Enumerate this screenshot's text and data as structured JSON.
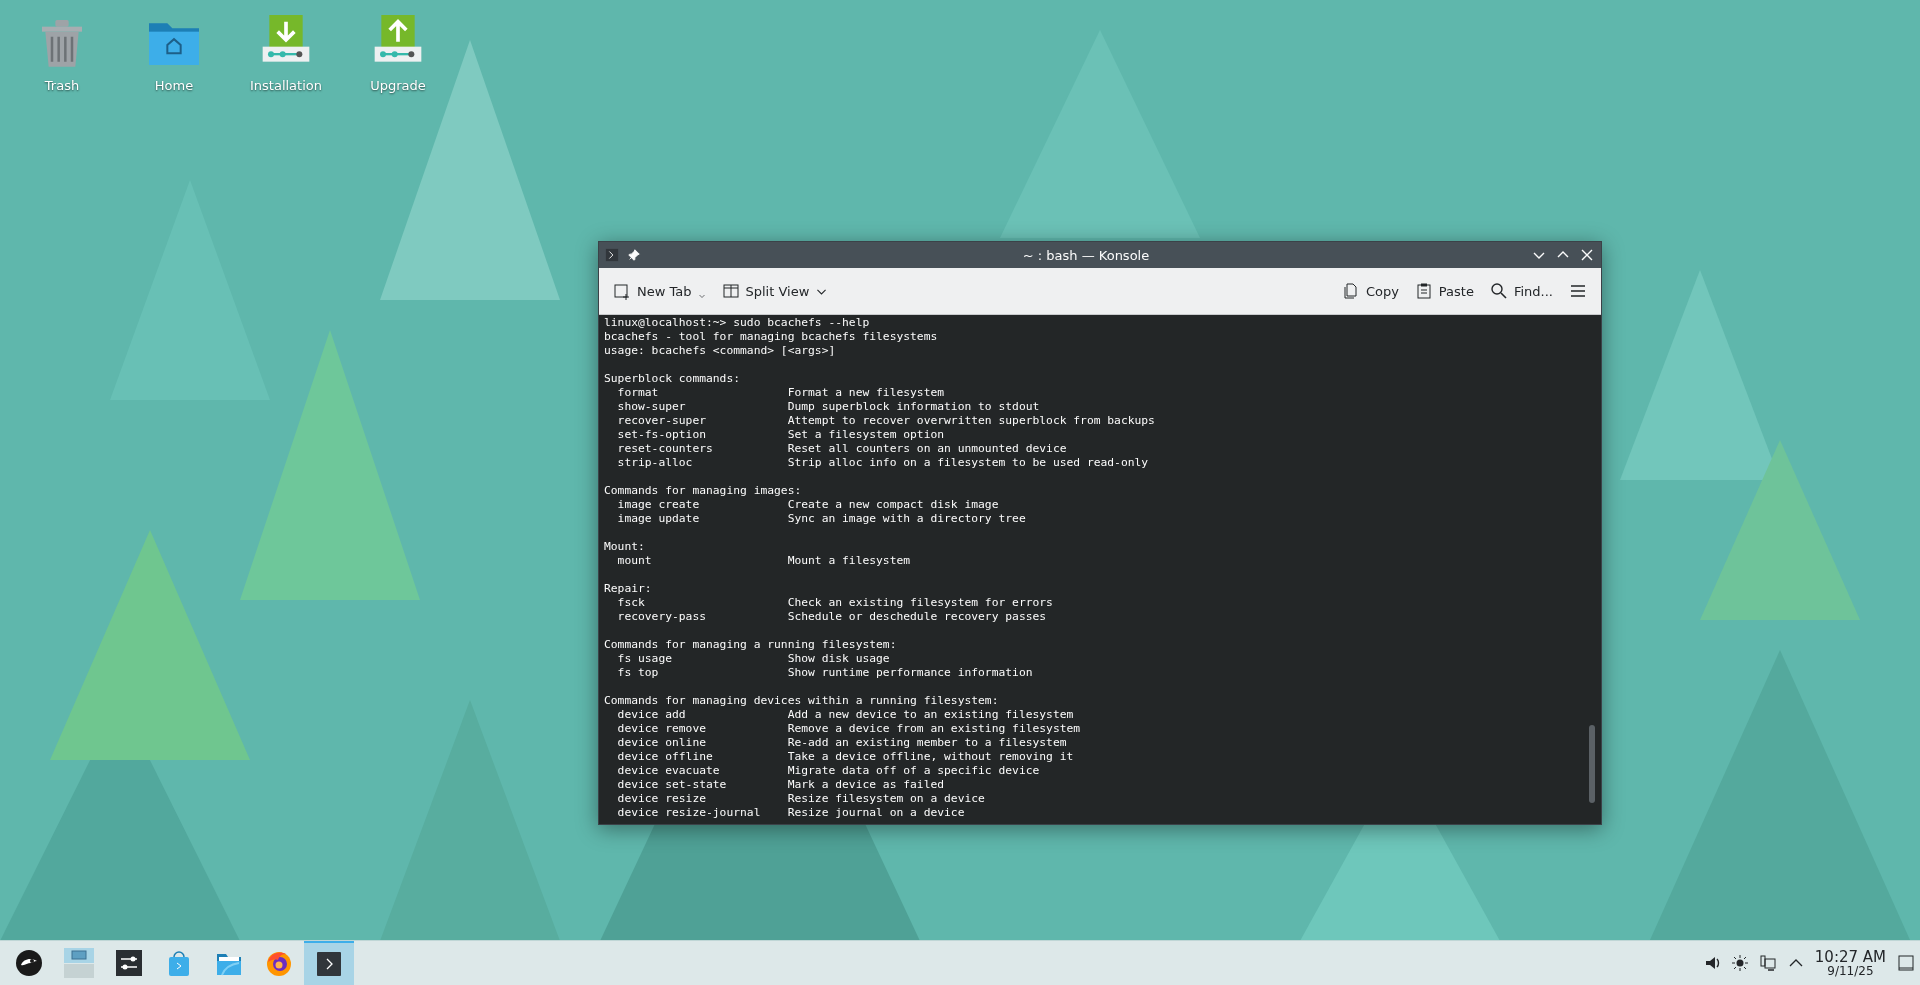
{
  "desktop_icons": [
    {
      "kind": "trash",
      "label": "Trash"
    },
    {
      "kind": "home",
      "label": "Home"
    },
    {
      "kind": "install",
      "label": "Installation"
    },
    {
      "kind": "upgrade",
      "label": "Upgrade"
    }
  ],
  "window": {
    "title": "~ : bash — Konsole",
    "toolbar_left": [
      {
        "kind": "newtab",
        "label": "New Tab"
      },
      {
        "kind": "split",
        "label": "Split View"
      }
    ],
    "toolbar_right": [
      {
        "kind": "copy",
        "label": "Copy"
      },
      {
        "kind": "paste",
        "label": "Paste"
      },
      {
        "kind": "find",
        "label": "Find..."
      },
      {
        "kind": "menu"
      }
    ],
    "terminal": {
      "blocks": [
        [
          "linux@localhost:~> sudo bcachefs --help",
          "bcachefs - tool for managing bcachefs filesystems",
          "usage: bcachefs <command> [<args>]"
        ],
        [
          "Superblock commands:",
          "  format                   Format a new filesystem",
          "  show-super               Dump superblock information to stdout",
          "  recover-super            Attempt to recover overwritten superblock from backups",
          "  set-fs-option            Set a filesystem option",
          "  reset-counters           Reset all counters on an unmounted device",
          "  strip-alloc              Strip alloc info on a filesystem to be used read-only"
        ],
        [
          "Commands for managing images:",
          "  image create             Create a new compact disk image",
          "  image update             Sync an image with a directory tree"
        ],
        [
          "Mount:",
          "  mount                    Mount a filesystem"
        ],
        [
          "Repair:",
          "  fsck                     Check an existing filesystem for errors",
          "  recovery-pass            Schedule or deschedule recovery passes"
        ],
        [
          "Commands for managing a running filesystem:",
          "  fs usage                 Show disk usage",
          "  fs top                   Show runtime performance information"
        ],
        [
          "Commands for managing devices within a running filesystem:",
          "  device add               Add a new device to an existing filesystem",
          "  device remove            Remove a device from an existing filesystem",
          "  device online            Re-add an existing member to a filesystem",
          "  device offline           Take a device offline, without removing it",
          "  device evacuate          Migrate data off of a specific device",
          "  device set-state         Mark a device as failed",
          "  device resize            Resize filesystem on a device",
          "  device resize-journal    Resize journal on a device"
        ]
      ]
    }
  },
  "taskbar": {
    "items": [
      {
        "kind": "launcher",
        "selected": false
      },
      {
        "kind": "pager",
        "selected": false
      },
      {
        "kind": "settings",
        "selected": false
      },
      {
        "kind": "store",
        "selected": false
      },
      {
        "kind": "files",
        "selected": false
      },
      {
        "kind": "browser",
        "selected": false
      },
      {
        "kind": "terminal",
        "selected": true
      }
    ],
    "tray": [
      {
        "kind": "volume"
      },
      {
        "kind": "brightness"
      },
      {
        "kind": "network"
      },
      {
        "kind": "expand"
      }
    ],
    "time": "10:27 AM",
    "date": "9/11/25"
  }
}
